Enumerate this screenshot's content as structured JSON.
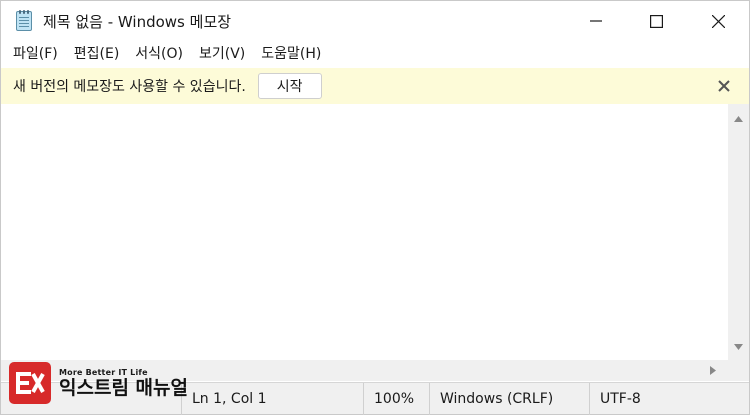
{
  "window": {
    "title": "제목 없음 - Windows 메모장",
    "icon": "notepad-icon",
    "controls": [
      "minimize-icon",
      "maximize-icon",
      "close-icon"
    ]
  },
  "menu": {
    "items": [
      "파일(F)",
      "편집(E)",
      "서식(O)",
      "보기(V)",
      "도움말(H)"
    ]
  },
  "infobar": {
    "message": "새 버전의 메모장도 사용할 수 있습니다.",
    "button_label": "시작",
    "background": "#fdfbd8"
  },
  "editor": {
    "content": ""
  },
  "statusbar": {
    "position": "Ln 1, Col 1",
    "zoom": "100%",
    "line_ending": "Windows (CRLF)",
    "encoding": "UTF-8"
  },
  "watermark": {
    "tagline": "More Better IT Life",
    "name": "익스트림 매뉴얼",
    "logo_color": "#d72a2a"
  }
}
